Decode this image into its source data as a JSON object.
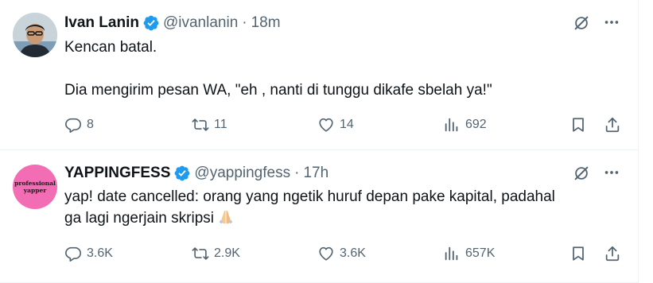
{
  "colors": {
    "text": "#0f1419",
    "secondary": "#536471",
    "verified": "#1d9bf0",
    "divider": "#eff3f4",
    "yapping_avatar_bg": "#f26db3"
  },
  "tweets": [
    {
      "author": {
        "name": "Ivan Lanin",
        "handle": "@ivanlanin",
        "verified": true
      },
      "separator": "·",
      "time": "18m",
      "text_line1": "Kencan batal.",
      "text_line2": "Dia mengirim pesan WA, \"eh , nanti di tunggu dikafe sbelah ya!\"",
      "stats": {
        "replies": "8",
        "reposts": "11",
        "likes": "14",
        "views": "692"
      }
    },
    {
      "author": {
        "name": "YAPPINGFESS",
        "handle": "@yappingfess",
        "verified": true,
        "avatar_text_line1": "professional",
        "avatar_text_line2": "yapper"
      },
      "separator": "·",
      "time": "17h",
      "text_line1": "yap! date cancelled: orang yang ngetik huruf depan pake kapital, padahal",
      "text_line2": "ga lagi ngerjain skripsi",
      "emoji": "folded-hands-emoji",
      "stats": {
        "replies": "3.6K",
        "reposts": "2.9K",
        "likes": "3.6K",
        "views": "657K"
      }
    }
  ],
  "icons": {
    "reply": "reply-icon",
    "repost": "repost-icon",
    "like": "heart-icon",
    "views": "views-icon",
    "bookmark": "bookmark-icon",
    "share": "share-icon",
    "grok": "grok-icon",
    "more": "more-icon",
    "verified": "verified-badge-icon"
  }
}
